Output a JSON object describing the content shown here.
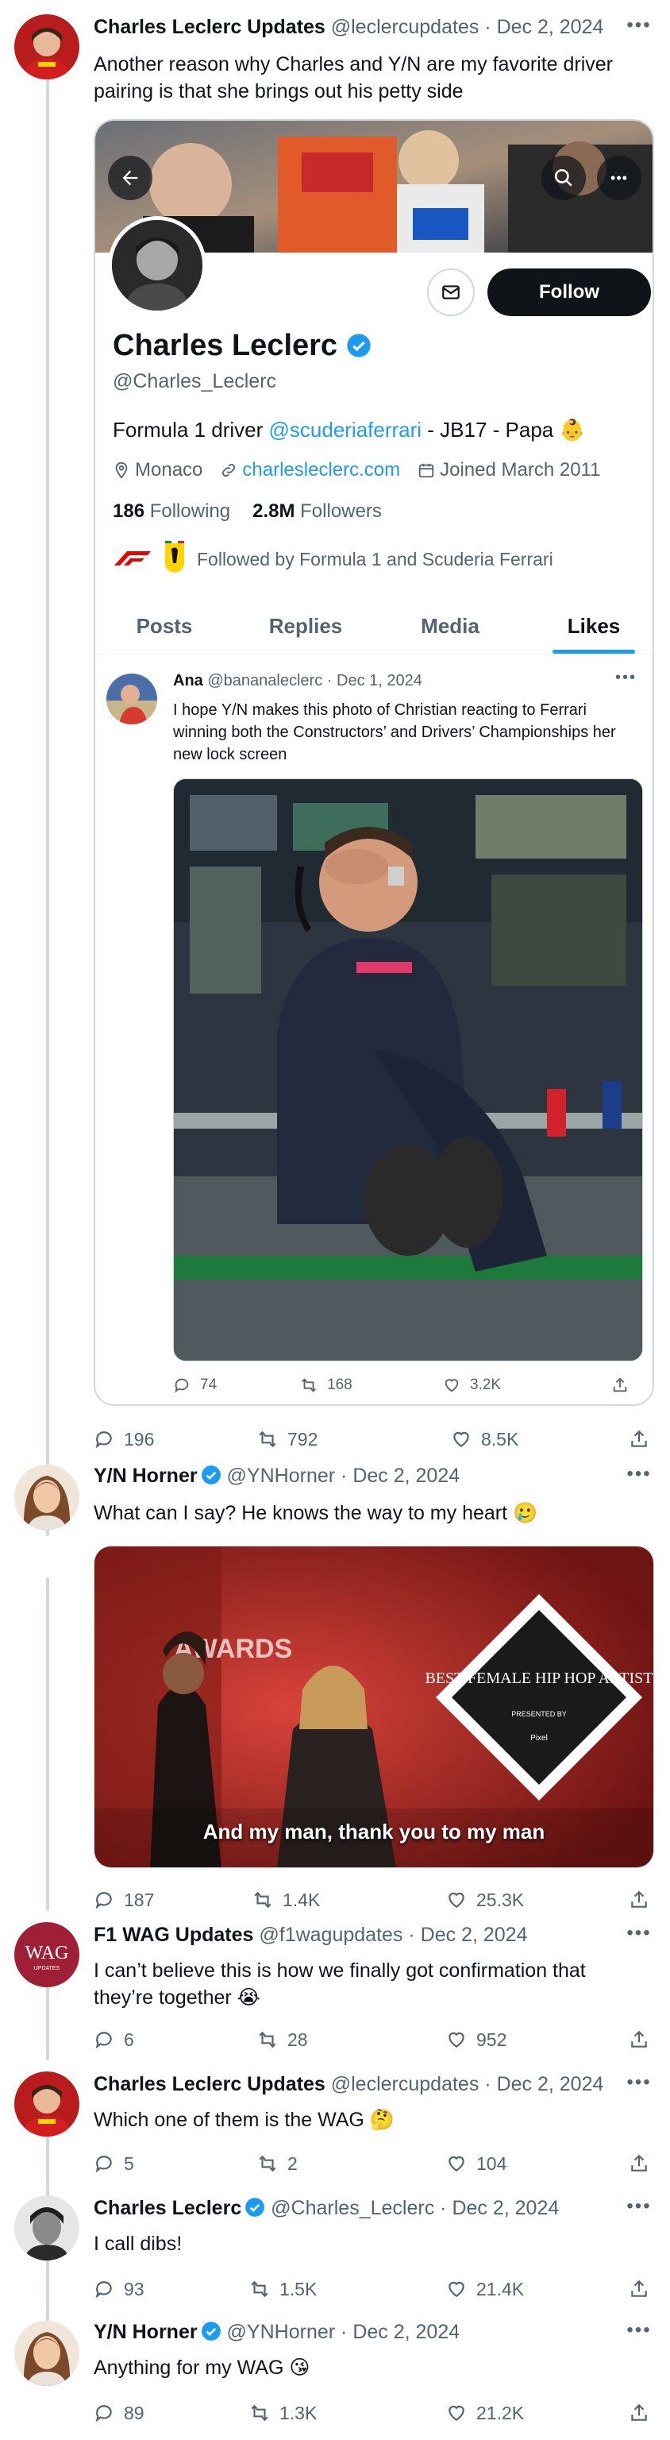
{
  "tweets": [
    {
      "name": "Charles Leclerc Updates",
      "handle": "@leclercupdates",
      "date": "Dec 2, 2024",
      "text": "Another reason why Charles and Y/N are my favorite driver pairing is that she brings out his petty side",
      "replies": "196",
      "retweets": "792",
      "likes": "8.5K"
    },
    {
      "name": "Y/N Horner",
      "handle": "@YNHorner",
      "date": "Dec 2, 2024",
      "text": "What can I say? He knows the way to my heart 🥲",
      "media_caption": "And my man, thank you to my man",
      "media_sign": "BEST FEMALE HIP HOP ARTIST",
      "media_sign_sub": "PRESENTED BY",
      "media_sign_brand": "Pixel",
      "media_awards": "AWARDS",
      "replies": "187",
      "retweets": "1.4K",
      "likes": "25.3K"
    },
    {
      "name": "F1 WAG Updates",
      "handle": "@f1wagupdates",
      "date": "Dec 2, 2024",
      "text": "I can’t believe this is how we finally got confirmation that they’re together 😭",
      "avatar_text": "WAG",
      "avatar_sub": "UPDATES",
      "replies": "6",
      "retweets": "28",
      "likes": "952"
    },
    {
      "name": "Charles Leclerc Updates",
      "handle": "@leclercupdates",
      "date": "Dec 2, 2024",
      "text": "Which one of them is the WAG 🤔",
      "replies": "5",
      "retweets": "2",
      "likes": "104"
    },
    {
      "name": "Charles Leclerc",
      "handle": "@Charles_Leclerc",
      "date": "Dec 2, 2024",
      "text": "I call dibs!",
      "replies": "93",
      "retweets": "1.5K",
      "likes": "21.4K"
    },
    {
      "name": "Y/N Horner",
      "handle": "@YNHorner",
      "date": "Dec 2, 2024",
      "text": "Anything for my WAG 😘",
      "replies": "89",
      "retweets": "1.3K",
      "likes": "21.2K"
    }
  ],
  "profile": {
    "name": "Charles Leclerc",
    "handle": "@Charles_Leclerc",
    "follow_label": "Follow",
    "bio_prefix": "Formula 1 driver ",
    "bio_mention": "@scuderiaferrari",
    "bio_suffix": " - JB17 - Papa 👶",
    "location": "Monaco",
    "website": "charlesleclerc.com",
    "joined": "Joined March 2011",
    "following_count": "186",
    "following_label": "Following",
    "followers_count": "2.8M",
    "followers_label": "Followers",
    "followed_by": "Followed by Formula 1 and Scuderia Ferrari",
    "tabs": [
      "Posts",
      "Replies",
      "Media",
      "Likes"
    ],
    "active_tab": "Likes"
  },
  "nested_tweet": {
    "name": "Ana",
    "handle": "@bananaleclerc",
    "date": "Dec 1, 2024",
    "text": "I hope Y/N makes this photo of Christian reacting to Ferrari winning both the Constructors’ and Drivers’ Championships her new lock screen",
    "replies": "74",
    "retweets": "168",
    "likes": "3.2K"
  },
  "colors": {
    "accent": "#1d9bf0",
    "text": "#0f1419",
    "muted": "#536471",
    "border": "#cfd9de"
  },
  "icons": [
    "reply-icon",
    "retweet-icon",
    "like-icon",
    "share-icon",
    "verified-icon",
    "more-icon",
    "back-arrow-icon",
    "search-icon",
    "mail-icon",
    "location-icon",
    "link-icon",
    "calendar-icon"
  ]
}
